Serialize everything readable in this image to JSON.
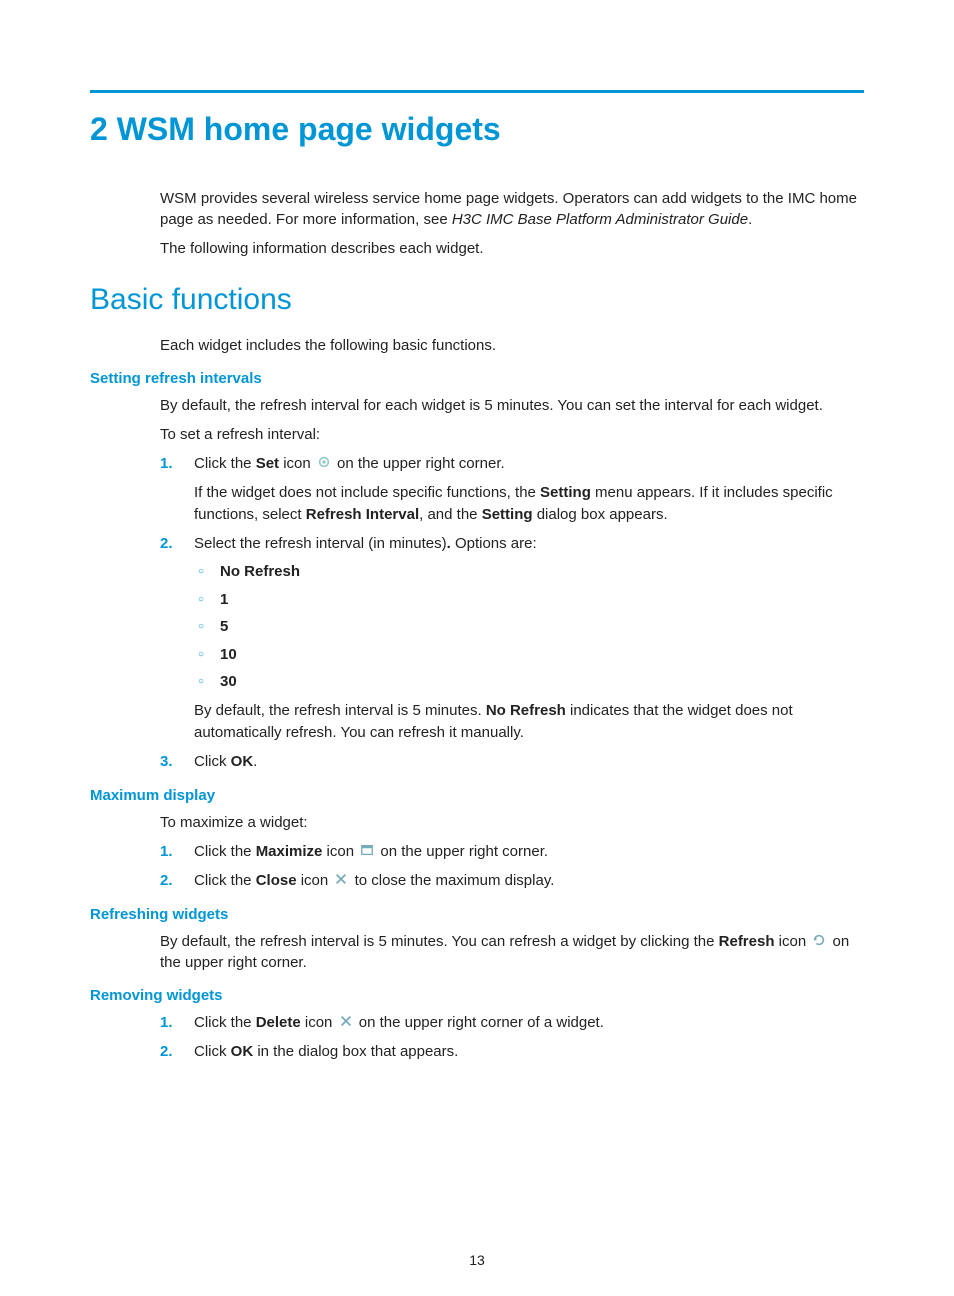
{
  "title": "2 WSM home page widgets",
  "intro1a": "WSM provides several wireless service home page widgets. Operators can add widgets to the IMC home page as needed. For more information, see ",
  "intro1b": "H3C IMC Base Platform Administrator Guide",
  "intro2": "The following information describes each widget.",
  "section_bf": "Basic functions",
  "bf_intro": "Each widget includes the following basic functions.",
  "sri": {
    "heading": "Setting refresh intervals",
    "p1": "By default, the refresh interval for each widget is 5 minutes. You can set the interval for each widget.",
    "p2": "To set a refresh interval:",
    "s1_a": "Click the ",
    "s1_b": "Set",
    "s1_c": " icon ",
    "s1_d": " on the upper right corner.",
    "s1_sub_a": "If the widget does not include specific functions, the ",
    "s1_sub_b": "Setting",
    "s1_sub_c": " menu appears. If it includes specific functions, select ",
    "s1_sub_d": "Refresh Interval",
    "s1_sub_e": ", and the ",
    "s1_sub_f": "Setting",
    "s1_sub_g": " dialog box appears.",
    "s2_a": "Select the refresh interval (in minutes)",
    "s2_b": ".",
    "s2_c": " Options are:",
    "opts": [
      "No Refresh",
      "1",
      "5",
      "10",
      "30"
    ],
    "s2_after_a": "By default, the refresh interval is 5 minutes. ",
    "s2_after_b": "No Refresh",
    "s2_after_c": " indicates that the widget does not automatically refresh. You can refresh it manually.",
    "s3_a": "Click ",
    "s3_b": "OK",
    "s3_c": "."
  },
  "max": {
    "heading": "Maximum display",
    "p1": "To maximize a widget:",
    "s1_a": "Click the ",
    "s1_b": "Maximize",
    "s1_c": " icon ",
    "s1_d": " on the upper right corner.",
    "s2_a": "Click the ",
    "s2_b": "Close",
    "s2_c": " icon ",
    "s2_d": " to close the maximum display."
  },
  "refresh": {
    "heading": "Refreshing widgets",
    "p_a": "By default, the refresh interval is 5 minutes. You can refresh a widget by clicking the ",
    "p_b": "Refresh",
    "p_c": " icon ",
    "p_d": " on the upper right corner."
  },
  "remove": {
    "heading": "Removing widgets",
    "s1_a": "Click the ",
    "s1_b": "Delete",
    "s1_c": " icon ",
    "s1_d": " on the upper right corner of a widget.",
    "s2_a": "Click ",
    "s2_b": "OK",
    "s2_c": " in the dialog box that appears."
  },
  "pagenum": "13"
}
